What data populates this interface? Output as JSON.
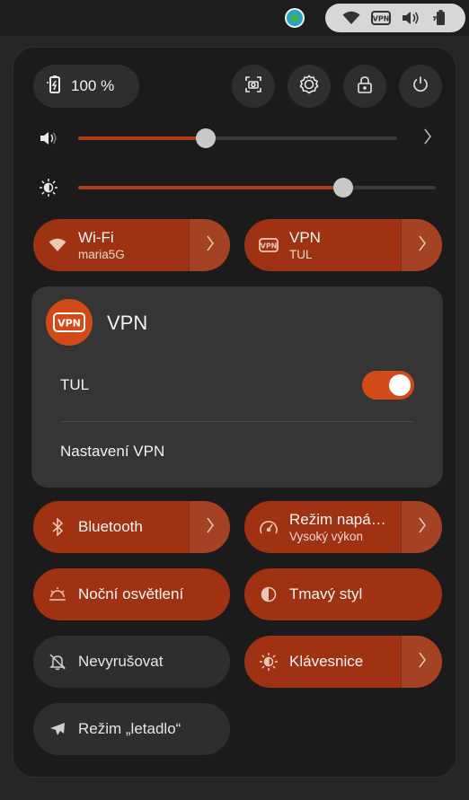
{
  "topbar": {
    "tray_app_icon": "app-indicator-icon",
    "status_icons": [
      "wifi-icon",
      "vpn-icon",
      "volume-icon",
      "battery-icon"
    ]
  },
  "panel": {
    "battery_label": "100 %",
    "actions": [
      "screenshot-icon",
      "settings-icon",
      "lock-icon",
      "power-icon"
    ],
    "volume": {
      "level": 0.4,
      "icon": "volume-icon"
    },
    "brightness": {
      "level": 0.74,
      "icon": "brightness-icon"
    },
    "wifi": {
      "title": "Wi-Fi",
      "subtitle": "maria5G"
    },
    "vpn_tile": {
      "title": "VPN",
      "subtitle": "TUL"
    },
    "vpn_menu": {
      "title": "VPN",
      "badge_text": "VPN",
      "connection": "TUL",
      "connection_on": true,
      "settings_label": "Nastavení VPN"
    },
    "bluetooth": {
      "title": "Bluetooth"
    },
    "power_mode": {
      "title": "Režim napá…",
      "subtitle": "Vysoký výkon"
    },
    "night_light": {
      "title": "Noční osvětlení"
    },
    "dark_style": {
      "title": "Tmavý styl"
    },
    "dnd": {
      "title": "Nevyrušovat"
    },
    "keyboard": {
      "title": "Klávesnice"
    },
    "airplane": {
      "title": "Režim „letadlo“"
    }
  },
  "colors": {
    "accent": "#9e3212",
    "accent_bright": "#d24a18",
    "panel": "#1b1b1b"
  }
}
